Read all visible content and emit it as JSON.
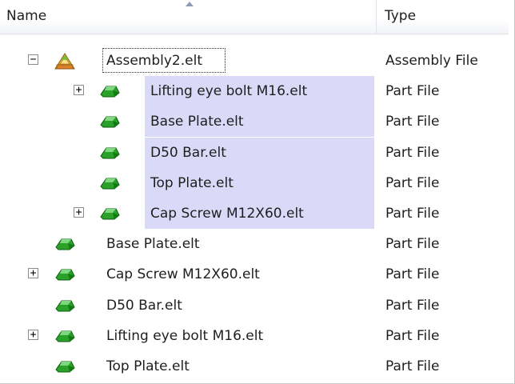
{
  "columns": {
    "name": "Name",
    "type": "Type"
  },
  "rows": [
    {
      "name": "Assembly2.elt",
      "type": "Assembly File",
      "expander": "−",
      "icon": "assembly-icon",
      "level": 0,
      "selected": false,
      "focused": true
    },
    {
      "name": "Lifting eye bolt M16.elt",
      "type": "Part File",
      "expander": "+",
      "icon": "part-icon",
      "level": 1,
      "selected": true
    },
    {
      "name": "Base Plate.elt",
      "type": "Part File",
      "expander": "",
      "icon": "part-icon",
      "level": 1,
      "selected": true
    },
    {
      "name": "D50 Bar.elt",
      "type": "Part File",
      "expander": "",
      "icon": "part-icon",
      "level": 1,
      "selected": true
    },
    {
      "name": "Top Plate.elt",
      "type": "Part File",
      "expander": "",
      "icon": "part-icon",
      "level": 1,
      "selected": true
    },
    {
      "name": "Cap Screw M12X60.elt",
      "type": "Part File",
      "expander": "+",
      "icon": "part-icon",
      "level": 1,
      "selected": true
    },
    {
      "name": "Base Plate.elt",
      "type": "Part File",
      "expander": "",
      "icon": "part-icon",
      "level": 0,
      "selected": false
    },
    {
      "name": "Cap Screw M12X60.elt",
      "type": "Part File",
      "expander": "+",
      "icon": "part-icon",
      "level": 0,
      "selected": false
    },
    {
      "name": "D50 Bar.elt",
      "type": "Part File",
      "expander": "",
      "icon": "part-icon",
      "level": 0,
      "selected": false
    },
    {
      "name": "Lifting eye bolt M16.elt",
      "type": "Part File",
      "expander": "+",
      "icon": "part-icon",
      "level": 0,
      "selected": false
    },
    {
      "name": "Top Plate.elt",
      "type": "Part File",
      "expander": "",
      "icon": "part-icon",
      "level": 0,
      "selected": false
    }
  ],
  "colors": {
    "selection": "#dadaf8",
    "part_green": "#2aa22a",
    "assembly_orange": "#f0a020"
  }
}
